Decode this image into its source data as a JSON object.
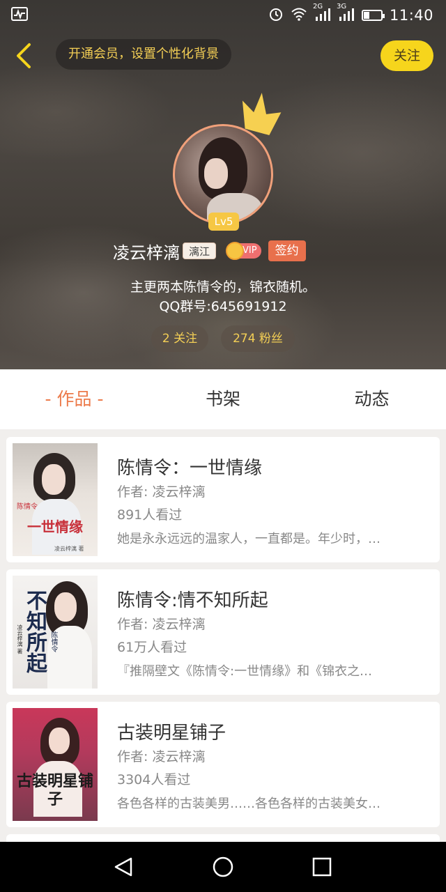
{
  "status_bar": {
    "time": "11:40",
    "network_1": "2G",
    "network_2": "3G",
    "battery_level": 0.35,
    "icons": [
      "activity-icon",
      "alarm-icon",
      "wifi-icon",
      "signal-icon",
      "signal-icon",
      "battery-icon"
    ]
  },
  "header": {
    "promo_text": "开通会员，设置个性化背景",
    "follow_label": "关注",
    "level": "Lv5",
    "username": "凌云梓漓",
    "title_tag": "漓江",
    "vip_label": "VIP",
    "sign_label": "签约",
    "bio_line1": "主更两本陈情令的，锦衣随机。",
    "bio_line2": "QQ群号:645691912",
    "following": "2 关注",
    "followers": "274 粉丝"
  },
  "tabs": [
    {
      "label": "- 作品 -",
      "active": true
    },
    {
      "label": "书架",
      "active": false
    },
    {
      "label": "动态",
      "active": false
    }
  ],
  "books": [
    {
      "title": "陈情令：一世情缘",
      "author": "作者: 凌云梓漓",
      "views": "891人看过",
      "desc": "她是永永远远的温家人，一直都是。年少时，…",
      "cover_text": "一世情缘",
      "cover_sub": "陈情令",
      "cover_author": "凌云梓漓 著"
    },
    {
      "title": "陈情令:情不知所起",
      "author": "作者: 凌云梓漓",
      "views": "61万人看过",
      "desc": "『推隔壁文《陈情令:一世情缘》和《锦衣之…",
      "cover_text": "不知所起",
      "cover_sub": "陈情令",
      "cover_author": "凌云梓漓 著"
    },
    {
      "title": "古装明星铺子",
      "author": "作者: 凌云梓漓",
      "views": "3304人看过",
      "desc": "各色各样的古装美男……各色各样的古装美女…",
      "cover_text": "古装明星铺子",
      "cover_sub": "",
      "cover_author": ""
    }
  ],
  "colors": {
    "accent": "#ec7a4a",
    "follow_bg": "#f6d51c",
    "promo_text": "#f4cf55",
    "level_bg": "#f6c744"
  }
}
